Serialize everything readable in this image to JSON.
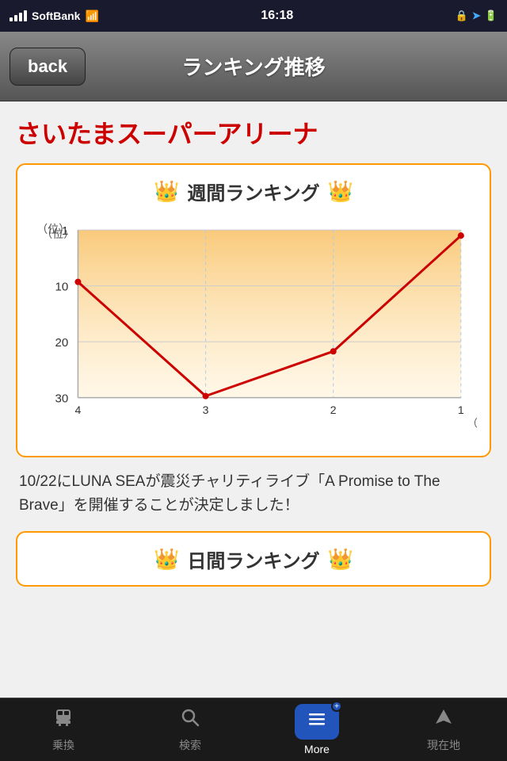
{
  "statusBar": {
    "carrier": "SoftBank",
    "time": "16:18"
  },
  "navBar": {
    "backLabel": "back",
    "title": "ランキング推移"
  },
  "mainContent": {
    "venueTitle": "さいたまスーパーアリーナ",
    "weeklyRanking": {
      "title": "週間ランキング",
      "crownEmoji": "👑",
      "yAxisLabel": "（位）",
      "xAxisLabel": "（週）",
      "yAxisValues": [
        "1",
        "10",
        "20",
        "30"
      ],
      "xAxisValues": [
        "4",
        "3",
        "2",
        "1"
      ]
    },
    "descriptionText": "10/22にLUNA SEAが震災チャリティライブ「A Promise to The Brave」を開催することが決定しました！",
    "dailyRanking": {
      "title": "日間ランキング",
      "crownEmoji": "👑"
    }
  },
  "tabBar": {
    "items": [
      {
        "id": "transit",
        "label": "乗換",
        "icon": "🚌",
        "active": false
      },
      {
        "id": "search",
        "label": "検索",
        "icon": "🔍",
        "active": false
      },
      {
        "id": "more",
        "label": "More",
        "icon": "≡",
        "active": true
      },
      {
        "id": "location",
        "label": "現在地",
        "icon": "▲",
        "active": false
      }
    ]
  }
}
